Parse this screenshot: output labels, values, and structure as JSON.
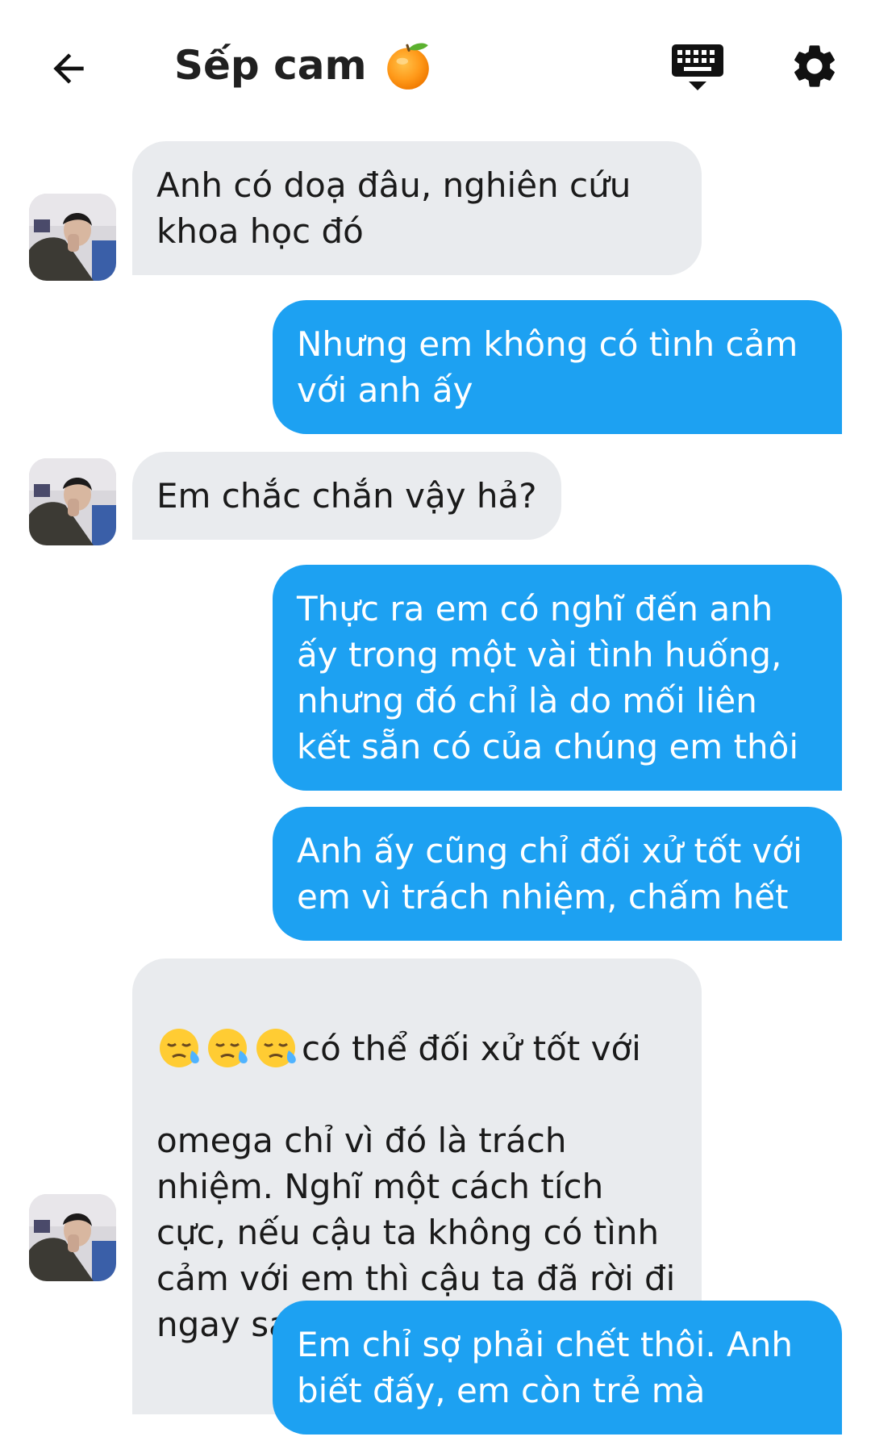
{
  "header": {
    "title": "Sếp cam",
    "title_icon": "orange-icon",
    "back_icon": "arrow-left-icon",
    "keyboard_icon": "keyboard-icon",
    "settings_icon": "gear-icon"
  },
  "colors": {
    "outgoing_bubble": "#1da1f2",
    "incoming_bubble": "#e9ebee",
    "outgoing_text": "#ffffff",
    "incoming_text": "#1a1a1a"
  },
  "messages": [
    {
      "direction": "incoming",
      "text": "Anh có doạ đâu, nghiên cứu\nkhoa học đó"
    },
    {
      "direction": "outgoing",
      "text": "Nhưng em không có tình cảm\nvới anh ấy"
    },
    {
      "direction": "incoming",
      "text": "Em chắc chắn vậy hả?"
    },
    {
      "direction": "outgoing",
      "text": "Thực ra em có nghĩ đến anh\nấy trong một vài tình huống,\nnhưng đó chỉ là do mối liên\nkết sẵn có của chúng em thôi"
    },
    {
      "direction": "outgoing",
      "text": "Anh ấy cũng chỉ đối xử tốt với\nem vì trách nhiệm, chấm hết"
    },
    {
      "direction": "incoming",
      "emoji": "sad-relieved-face-icon",
      "emoji_count": 3,
      "text_first_line": "có thể đối xử tốt với",
      "text": "omega chỉ vì đó là trách\nnhiệm. Nghĩ một cách tích\ncực, nếu cậu ta không có tình\ncảm với em thì cậu ta đã rời đi\nngay sau khi đánh dấu em rồi"
    },
    {
      "direction": "outgoing",
      "text": "Em chỉ sợ phải chết thôi. Anh\nbiết đấy, em còn trẻ mà"
    }
  ]
}
